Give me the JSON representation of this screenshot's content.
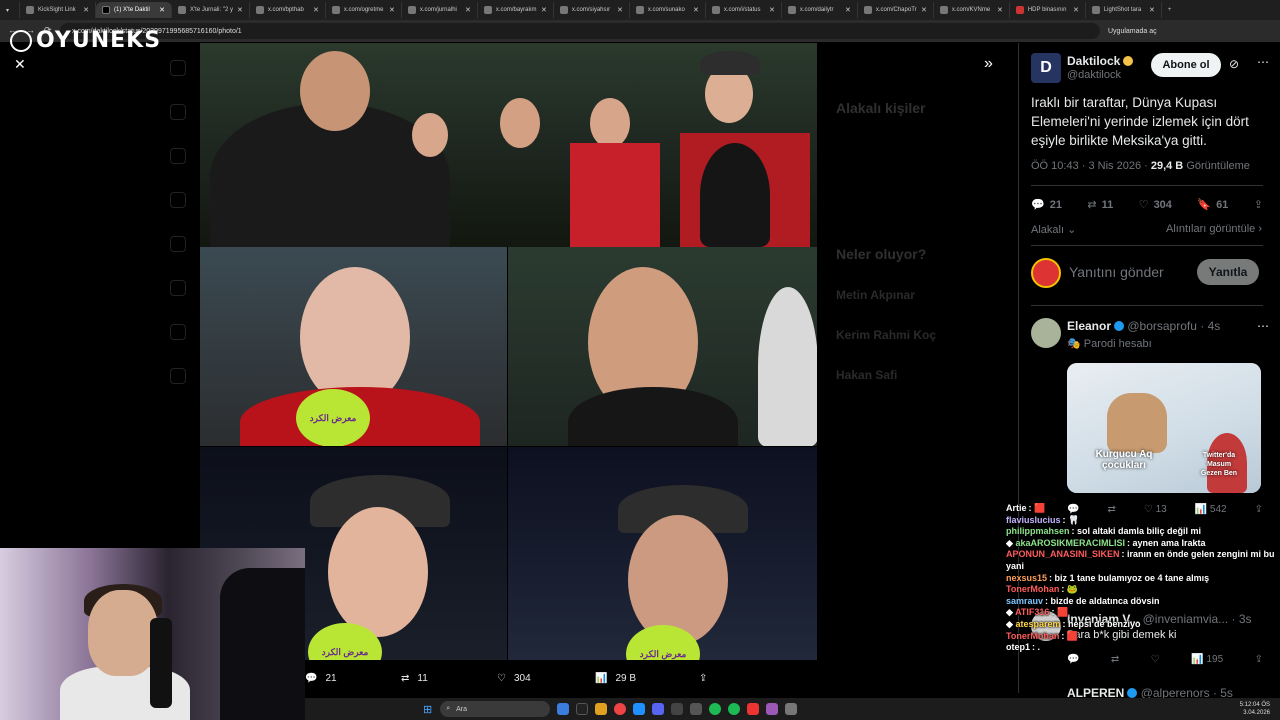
{
  "browser": {
    "tabs": [
      {
        "label": "KickSight Link",
        "active": false
      },
      {
        "label": "(1) X'te Daktil",
        "active": true
      },
      {
        "label": "X'te Jurnali: \"2 y",
        "active": false
      },
      {
        "label": "x.com/bpthab",
        "active": false
      },
      {
        "label": "x.com/ogretme",
        "active": false
      },
      {
        "label": "x.com/jurnalhi",
        "active": false
      },
      {
        "label": "x.com/bayrakm",
        "active": false
      },
      {
        "label": "x.com/siyahsır",
        "active": false
      },
      {
        "label": "x.com/sunako",
        "active": false
      },
      {
        "label": "x.com/i/status",
        "active": false
      },
      {
        "label": "x.com/dailytr",
        "active": false
      },
      {
        "label": "x.com/ChapoTr",
        "active": false
      },
      {
        "label": "x.com/KVNme",
        "active": false
      },
      {
        "label": "HDP binasının",
        "active": false
      },
      {
        "label": "LightShot tara",
        "active": false
      }
    ],
    "url": "x.com/daktilock/status/2039971995685716160/photo/1",
    "open_in_app": "Uygulamada aç"
  },
  "overlay": {
    "logo_text": "OYUNEKS"
  },
  "media": {
    "mic_label": "معرض الكرد"
  },
  "dim_right": {
    "related_title": "Alakalı kişiler",
    "trending_title": "Neler oluyor?",
    "items": [
      "Metin Akpınar",
      "Kerim Rahmi Koç",
      "Hakan Safi"
    ]
  },
  "media_actions": {
    "replies": "21",
    "reposts": "11",
    "likes": "304",
    "views": "29 B"
  },
  "tweet": {
    "author_name": "Daktilock",
    "author_handle": "@daktilock",
    "follow_label": "Abone ol",
    "text": "Iraklı bir taraftar, Dünya Kupası Elemeleri'ni yerinde izlemek için dört eşiyle birlikte Meksika'ya gitti.",
    "time": "ÖÖ 10:43 · 3 Nis 2026 · ",
    "views_count": "29,4 B",
    "views_label": " Görüntüleme",
    "replies": "21",
    "reposts": "11",
    "likes": "304",
    "bookmarks": "61",
    "related_label": "Alakalı",
    "quotes_label": "Alıntıları görüntüle",
    "reply_placeholder": "Yanıtını gönder",
    "reply_button": "Yanıtla"
  },
  "replies": [
    {
      "name": "Eleanor",
      "handle": "@borsaprofu · 4s",
      "sub": "Parodi hesabı",
      "meme_left": "Kurgucu Aq çocukları",
      "meme_right": "Twitter'da Masum Gezen Ben",
      "views": "542",
      "likes": "13"
    },
    {
      "name": "Inveniam V...",
      "handle": "@inveniamvia... · 3s",
      "sub": "Para b*k gibi demek ki",
      "views": "195"
    },
    {
      "name": "ALPEREN",
      "handle": "@alperenors · 5s"
    }
  ],
  "chat": [
    {
      "user": "Artie",
      "text": "",
      "color": "#ffffff"
    },
    {
      "user": "flaviuslucius",
      "text": "",
      "color": "#c3b1ff"
    },
    {
      "user": "philippmahsen",
      "text": "sol altaki damla biliç değil mi",
      "color": "#8be28b"
    },
    {
      "user": "akaAROSIKMERACIMLISI",
      "text": "aynen ama Irakta",
      "color": "#8be28b"
    },
    {
      "user": "APONUN_ANASINI_SIKEN",
      "text": "iranın en önde gelen zengini mi bu yani",
      "color": "#ff5b5b"
    },
    {
      "user": "nexsus15",
      "text": "biz 1 tane bulamıyoz oe 4 tane almış",
      "color": "#ff9f5b"
    },
    {
      "user": "TonerMohan",
      "text": "",
      "color": "#ff5b5b"
    },
    {
      "user": "samrauv",
      "text": "bizde de aldatınca dövsin",
      "color": "#7ec8ff"
    },
    {
      "user": "ATIF316",
      "text": "",
      "color": "#ff5b5b"
    },
    {
      "user": "atesparem",
      "text": "hepsi de benziyo",
      "color": "#ffd84a"
    },
    {
      "user": "TonerMohan",
      "text": "",
      "color": "#ff5b5b"
    },
    {
      "user": "otep1",
      "text": ".",
      "color": "#ffffff"
    }
  ],
  "taskbar": {
    "search": "Ara",
    "time": "5:12:04 ÖS",
    "date": "3.04.2026"
  },
  "colors": {
    "accent": "#1d9bf0",
    "bg": "#000000",
    "muted": "#71767b"
  }
}
